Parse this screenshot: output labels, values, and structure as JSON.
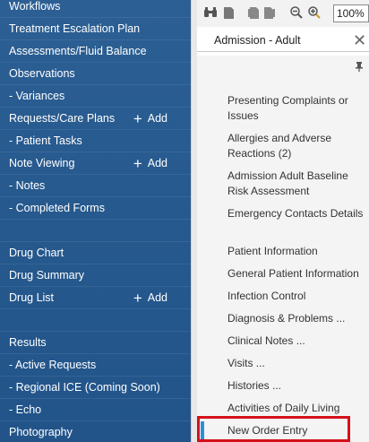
{
  "sidebar": {
    "items": [
      {
        "label": "Workflows",
        "add": false
      },
      {
        "label": "Treatment Escalation Plan",
        "add": false
      },
      {
        "label": "Assessments/Fluid Balance",
        "add": false
      },
      {
        "label": "Observations",
        "add": false
      },
      {
        "label": "- Variances",
        "add": false
      },
      {
        "label": "Requests/Care Plans",
        "add": true
      },
      {
        "label": "- Patient Tasks",
        "add": false
      },
      {
        "label": "Note Viewing",
        "add": true
      },
      {
        "label": "- Notes",
        "add": false
      },
      {
        "label": "- Completed Forms",
        "add": false
      },
      {
        "label": "",
        "add": false
      },
      {
        "label": "Drug Chart",
        "add": false
      },
      {
        "label": "Drug Summary",
        "add": false
      },
      {
        "label": "Drug List",
        "add": true
      },
      {
        "label": "",
        "add": false
      },
      {
        "label": "Results",
        "add": false
      },
      {
        "label": "- Active Requests",
        "add": false
      },
      {
        "label": "- Regional ICE (Coming Soon)",
        "add": false
      },
      {
        "label": "- Echo",
        "add": false
      },
      {
        "label": "Photography",
        "add": false
      }
    ],
    "add_label": "Add"
  },
  "toolbar": {
    "zoom_value": "100%"
  },
  "panel": {
    "title": "Admission - Adult",
    "items": [
      "Presenting Complaints or Issues",
      "Allergies and Adverse Reactions (2)",
      "Admission Adult Baseline Risk Assessment",
      "Emergency Contacts Details",
      "Patient Information",
      "General Patient Information",
      "Infection Control",
      "Diagnosis & Problems ...",
      "Clinical Notes ...",
      "Visits ...",
      "Histories ...",
      "Activities of Daily Living",
      "New Order Entry"
    ],
    "selected_index": 12
  },
  "colors": {
    "sidebar_bg": "#26598d",
    "selected_accent": "#2b8fd8",
    "highlight": "#d4111a"
  }
}
